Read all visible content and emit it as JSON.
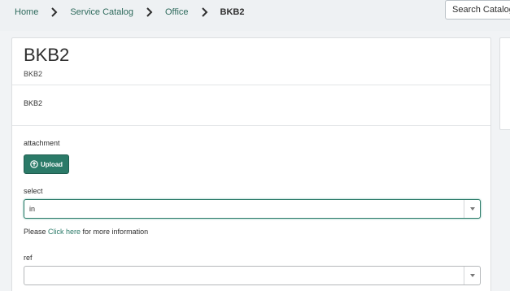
{
  "breadcrumb": {
    "items": [
      "Home",
      "Service Catalog",
      "Office"
    ],
    "current": "BKB2"
  },
  "header": {
    "search_label": "Search Catalog"
  },
  "item": {
    "title": "BKB2",
    "short_description": "BKB2",
    "description": "BKB2"
  },
  "form": {
    "attachment_label": "attachment",
    "upload_label": "Upload",
    "select_label": "select",
    "select_value": "in",
    "info_prefix": "Please ",
    "info_link": "Click here",
    "info_suffix": " for more information",
    "ref_label": "ref",
    "ref_value": ""
  },
  "colors": {
    "accent": "#2b7a68",
    "link": "#2e6a5c"
  }
}
